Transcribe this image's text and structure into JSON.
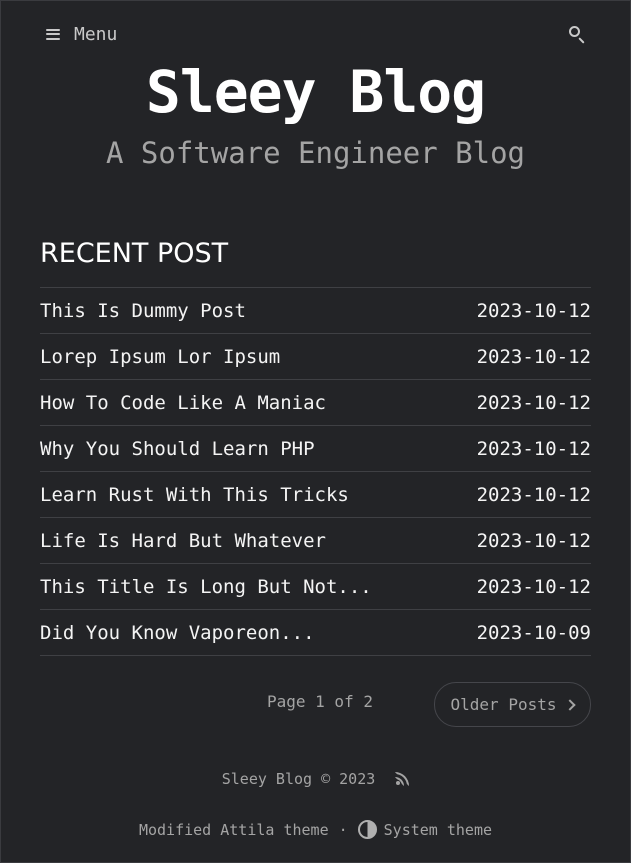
{
  "header": {
    "menu_label": "Menu",
    "menu_icon": "hamburger-icon",
    "search_icon": "search-icon"
  },
  "site": {
    "title": "Sleey Blog",
    "subtitle": "A Software Engineer Blog"
  },
  "recent": {
    "heading": "RECENT POST",
    "posts": [
      {
        "title": "This Is Dummy Post",
        "date": "2023-10-12"
      },
      {
        "title": "Lorep Ipsum Lor Ipsum",
        "date": "2023-10-12"
      },
      {
        "title": "How To Code Like A Maniac",
        "date": "2023-10-12"
      },
      {
        "title": "Why You Should Learn PHP",
        "date": "2023-10-12"
      },
      {
        "title": "Learn Rust With This Tricks",
        "date": "2023-10-12"
      },
      {
        "title": "Life Is Hard But Whatever",
        "date": "2023-10-12"
      },
      {
        "title": "This Title Is Long But Not...",
        "date": "2023-10-12"
      },
      {
        "title": "Did You Know Vaporeon...",
        "date": "2023-10-09"
      }
    ]
  },
  "pagination": {
    "page_info": "Page 1 of 2",
    "older_label": "Older Posts"
  },
  "footer": {
    "copyright": "Sleey Blog © 2023",
    "rss_icon": "rss-icon",
    "theme_credit": "Modified Attila theme",
    "separator": "·",
    "theme_toggle_label": "System theme"
  },
  "colors": {
    "background": "#232427",
    "text": "#f1f1f1",
    "muted": "#a4a4a4",
    "divider": "#3f4044"
  }
}
